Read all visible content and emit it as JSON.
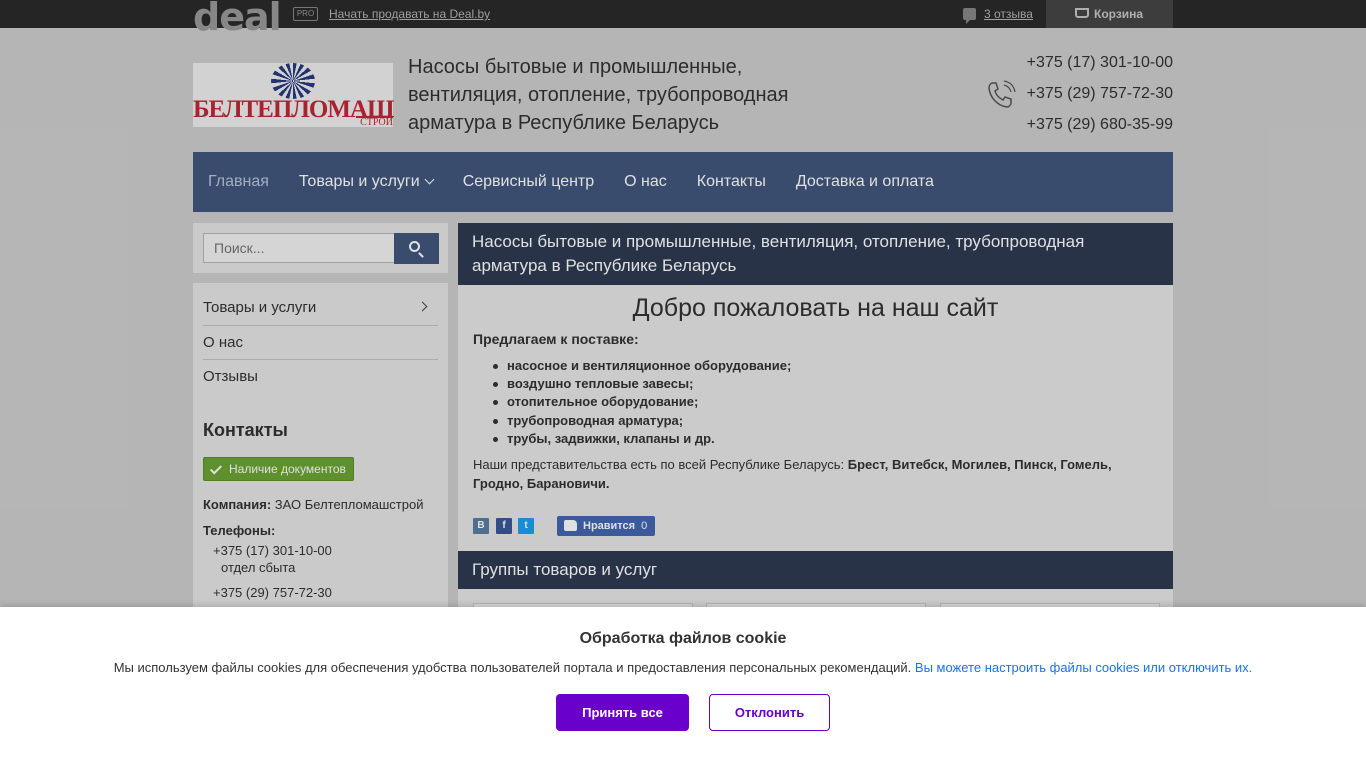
{
  "topbar": {
    "logo_text": "deal",
    "pro_badge": "PRO",
    "sell_link": "Начать продавать на Deal.by",
    "reviews_link": "3 отзыва",
    "cart_label": "Корзина"
  },
  "header": {
    "logo_text": "БЕЛТЕПЛОМАШ",
    "logo_sub": "СТРОЙ",
    "title": "Насосы бытовые и промышленные, вентиляция, отопление, трубопроводная арматура в Республике Беларусь",
    "phones": [
      "+375 (17) 301-10-00",
      "+375 (29) 757-72-30",
      "+375 (29) 680-35-99"
    ]
  },
  "nav": {
    "items": [
      {
        "label": "Главная",
        "active": true
      },
      {
        "label": "Товары и услуги"
      },
      {
        "label": "Сервисный центр"
      },
      {
        "label": "О нас"
      },
      {
        "label": "Контакты"
      },
      {
        "label": "Доставка и оплата"
      }
    ]
  },
  "sidebar": {
    "search_placeholder": "Поиск...",
    "menu": [
      {
        "label": "Товары и услуги"
      },
      {
        "label": "О нас"
      },
      {
        "label": "Отзывы"
      }
    ],
    "contacts_title": "Контакты",
    "docs_badge": "Наличие документов",
    "company_label": "Компания:",
    "company_name": "ЗАО Белтепломашстрой",
    "phones_label": "Телефоны:",
    "phones": [
      {
        "number": "+375 (17) 301-10-00",
        "note": "отдел сбыта"
      },
      {
        "number": "+375 (29) 757-72-30"
      }
    ]
  },
  "main": {
    "heading": "Насосы бытовые и промышленные, вентиляция, отопление, трубопроводная арматура в Республике Беларусь",
    "welcome": "Добро пожаловать на наш сайт",
    "offer_label": "Предлагаем к поставке:",
    "offer_items": [
      "насосное и вентиляционное оборудование;",
      "воздушно тепловые завесы;",
      "отопительное оборудование;",
      "трубопроводная арматура;",
      "трубы, задвижки, клапаны и др."
    ],
    "reps_text": "Наши представительства есть по всей Республике Беларусь:",
    "reps_cities": "Брест, Витебск, Могилев, Пинск, Гомель, Гродно, Барановичи.",
    "share": {
      "vk": "В",
      "fb": "f",
      "tw": "t"
    },
    "like_label": "Нравится",
    "like_count": "0",
    "groups_heading": "Группы товаров и услуг",
    "colors": {
      "nav": "#43577d",
      "section_head": "#2e3b52"
    }
  },
  "cookie": {
    "title": "Обработка файлов cookie",
    "text": "Мы используем файлы cookies для обеспечения удобства пользователей портала и предоставления персональных рекомендаций.",
    "link": "Вы можете настроить файлы cookies или отключить их.",
    "accept": "Принять все",
    "decline": "Отклонить",
    "accent": "#6a00cc"
  }
}
